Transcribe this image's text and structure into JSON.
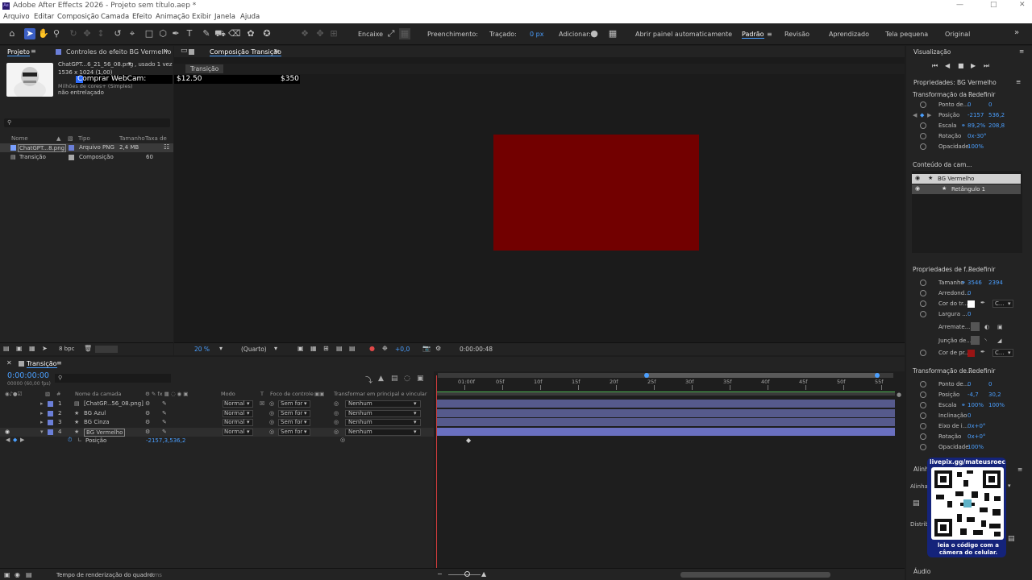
{
  "window": {
    "title": "Adobe After Effects 2026 - Projeto sem título.aep *",
    "logo_text": "Ae"
  },
  "menu": [
    "Arquivo",
    "Editar",
    "Composição",
    "Camada",
    "Efeito",
    "Animação",
    "Exibir",
    "Janela",
    "Ajuda"
  ],
  "toolbar": {
    "encaixe": "Encaixe",
    "preenchimento": "Preenchimento:",
    "tracado": "Traçado:",
    "tracado_px": "0 px",
    "adicionar": "Adicionar:",
    "abrir_painel": "Abrir painel automaticamente",
    "fill_color": "#8b0000",
    "workspaces": [
      "Padrão",
      "Revisão",
      "Aprendizado",
      "Tela pequena",
      "Original"
    ]
  },
  "project_panel": {
    "tab_projeto": "Projeto",
    "tab_controles": "Controles do efeito BG Vermelho",
    "asset_name": "ChatGPT...6_21_56_08.png",
    "asset_usage": ", usado 1 vez",
    "asset_size": "1536 x 1024 (1,00)",
    "asset_colors": "Milhões de cores+ (Simples)",
    "asset_interlace": "não entrelaçado",
    "webcam_overlay": "Comprar WebCam:",
    "price_low": "$12.50",
    "price_high": "$350",
    "search_placeholder": "",
    "columns": {
      "nome": "Nome",
      "tipo": "Tipo",
      "tamanho": "Tamanho",
      "taxa": "Taxa de"
    },
    "items": [
      {
        "name": "ChatGPT...8.png",
        "type": "Arquivo PNG",
        "size": "2,4 MB",
        "rate": "",
        "color": "#6b7fd8"
      },
      {
        "name": "Transição",
        "type": "Composição",
        "size": "",
        "rate": "60",
        "color": "#a8a8a8"
      }
    ],
    "bpc": "8 bpc"
  },
  "viewer": {
    "tab": "Composição Transição",
    "chip": "Transição",
    "zoom": "20 %",
    "quality": "(Quarto)",
    "exposure": "+0,0",
    "timecode": "0:00:00:48",
    "rect_color": "#720000"
  },
  "right_panel": {
    "visualizacao": "Visualização",
    "props_title": "Propriedades: BG Vermelho",
    "transform_head": "Transformação da ...",
    "redefinir": "Redefinir",
    "transform": [
      {
        "label": "Ponto de...",
        "v1": "0",
        "v2": "0"
      },
      {
        "label": "Posição",
        "v1": "-2157",
        "v2": "536,2"
      },
      {
        "label": "Escala",
        "v1": "89,2%",
        "v2": "208,8"
      },
      {
        "label": "Rotação",
        "v1": "0x-30°",
        "v2": ""
      },
      {
        "label": "Opacidade",
        "v1": "100%",
        "v2": ""
      }
    ],
    "conteudo_head": "Conteúdo da cam...",
    "content_items": [
      "BG Vermelho",
      "Retângulo 1"
    ],
    "shape_head": "Propriedades de f...",
    "shape": [
      {
        "label": "Tamanho",
        "v1": "3546",
        "v2": "2394"
      },
      {
        "label": "Arredond...",
        "v1": "0",
        "v2": ""
      },
      {
        "label": "Cor do tr...",
        "v1": "",
        "v2": ""
      },
      {
        "label": "Largura ...",
        "v1": "0",
        "v2": ""
      },
      {
        "label": "Arremate...",
        "v1": "",
        "v2": ""
      },
      {
        "label": "Junção de...",
        "v1": "",
        "v2": ""
      },
      {
        "label": "Cor de pr...",
        "v1": "",
        "v2": ""
      }
    ],
    "c_label": "C...",
    "transform2_head": "Transformação de...",
    "transform2": [
      {
        "label": "Ponto de...",
        "v1": "0",
        "v2": "0"
      },
      {
        "label": "Posição",
        "v1": "-4,7",
        "v2": "30,2"
      },
      {
        "label": "Escala",
        "v1": "100%",
        "v2": "100%"
      },
      {
        "label": "Inclinação",
        "v1": "0",
        "v2": ""
      },
      {
        "label": "Eixo de i...",
        "v1": "0x+0°",
        "v2": ""
      },
      {
        "label": "Rotação",
        "v1": "0x+0°",
        "v2": ""
      },
      {
        "label": "Opacidade",
        "v1": "100%",
        "v2": ""
      }
    ],
    "alinhar": "Alinh",
    "alinhar2": "Alinha",
    "distrib": "Distrib",
    "audio": "Áudio",
    "qr_link": "livepix.gg/mateusroec",
    "qr_caption": "leia o código com a câmera do celular."
  },
  "timeline": {
    "tab": "Transição",
    "timecode": "0:00:00:00",
    "fps": "00000 (60,00 fps)",
    "col_hash": "#",
    "col_layer": "Nome da camada",
    "col_mode": "Modo",
    "col_t": "T",
    "col_focus": "Foco de controle",
    "col_parent": "Transformar em principal e vincular",
    "ruler": [
      "01:00f",
      "05f",
      "10f",
      "15f",
      "20f",
      "25f",
      "30f",
      "35f",
      "40f",
      "45f",
      "50f",
      "55f"
    ],
    "layers": [
      {
        "num": "1",
        "name": "[ChatGP...56_08.png]",
        "mode": "Normal",
        "focus": "Sem for",
        "parent": "Nenhum",
        "color": "#6b7fd8"
      },
      {
        "num": "2",
        "name": "BG Azul",
        "mode": "Normal",
        "focus": "Sem for",
        "parent": "Nenhum",
        "color": "#6b7fd8"
      },
      {
        "num": "3",
        "name": "BG Cinza",
        "mode": "Normal",
        "focus": "Sem for",
        "parent": "Nenhum",
        "color": "#6b7fd8"
      },
      {
        "num": "4",
        "name": "BG Vermelho",
        "mode": "Normal",
        "focus": "Sem for",
        "parent": "Nenhum",
        "color": "#6b7fd8"
      }
    ],
    "prop_name": "Posição",
    "prop_value": "-2157,3,536,2"
  },
  "status": {
    "render_label": "Tempo de renderização do quadro:",
    "render_value": "0ms"
  }
}
